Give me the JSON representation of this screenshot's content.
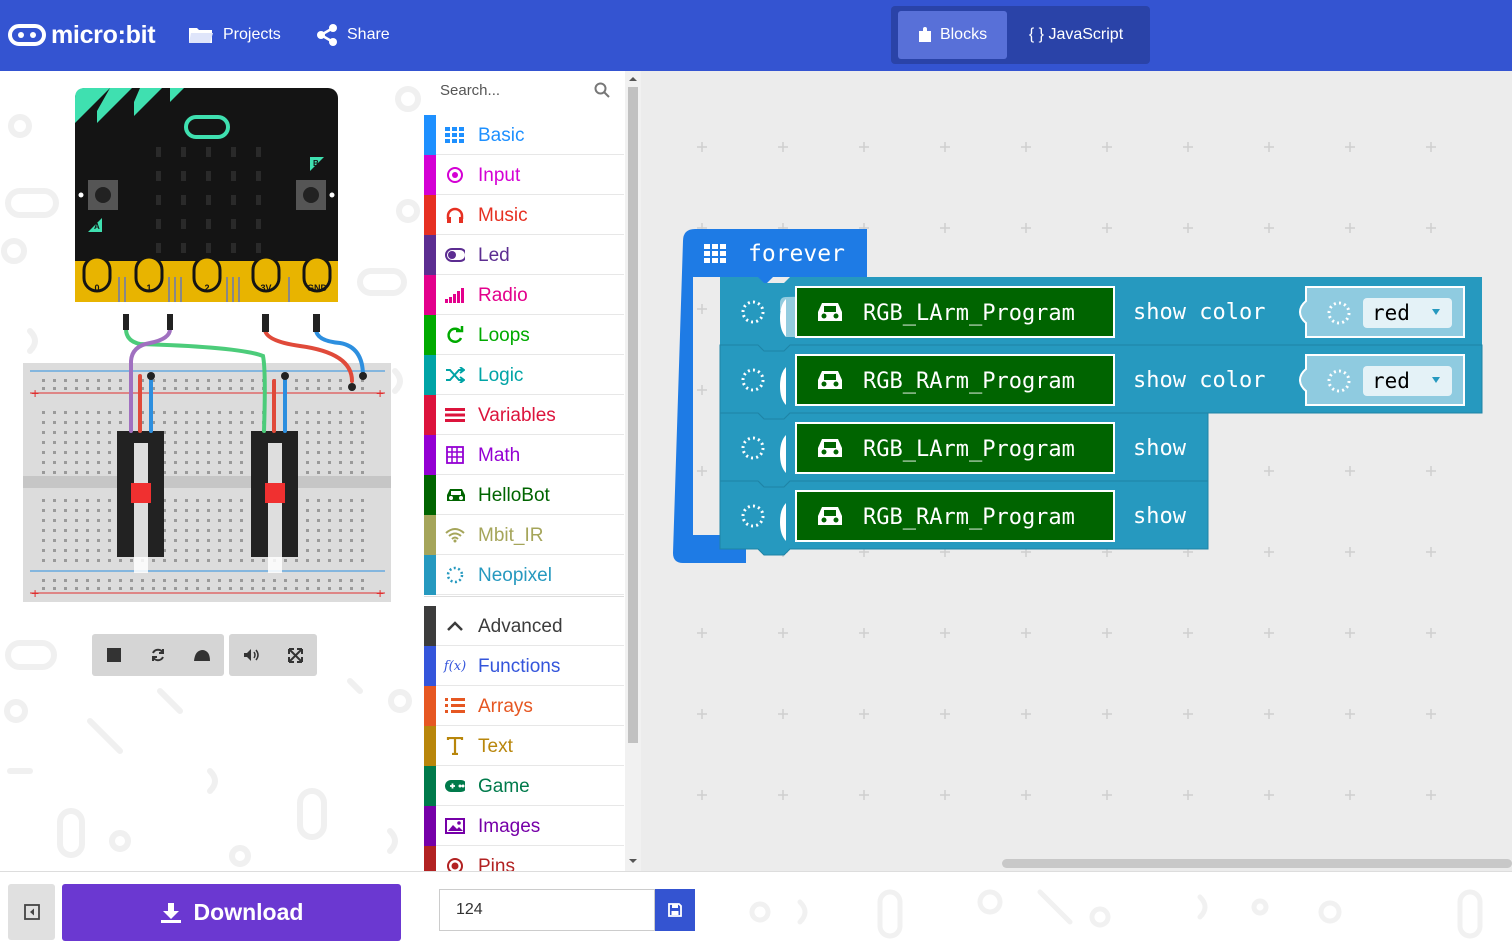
{
  "header": {
    "logo_text": "micro:bit",
    "projects_label": "Projects",
    "share_label": "Share",
    "mode_blocks_label": "Blocks",
    "mode_js_label": "{ } JavaScript"
  },
  "simulator": {
    "pin_labels": [
      "0",
      "1",
      "2",
      "3V",
      "GND"
    ],
    "button_a": "A",
    "button_b": "B",
    "controls": [
      "stop-icon",
      "restart-icon",
      "slowmo-icon",
      "mute-icon",
      "fullscreen-icon"
    ]
  },
  "toolbox": {
    "search_placeholder": "Search...",
    "categories": [
      {
        "label": "Basic",
        "color": "#1e90ff",
        "icon": "grid-icon"
      },
      {
        "label": "Input",
        "color": "#d400d4",
        "icon": "target-icon"
      },
      {
        "label": "Music",
        "color": "#e63022",
        "icon": "headphones-icon"
      },
      {
        "label": "Led",
        "color": "#5c2d91",
        "icon": "toggle-icon"
      },
      {
        "label": "Radio",
        "color": "#e3008c",
        "icon": "signal-icon"
      },
      {
        "label": "Loops",
        "color": "#00aa00",
        "icon": "loop-icon"
      },
      {
        "label": "Logic",
        "color": "#00a4a6",
        "icon": "shuffle-icon"
      },
      {
        "label": "Variables",
        "color": "#dc143c",
        "icon": "lines-icon"
      },
      {
        "label": "Math",
        "color": "#9400d3",
        "icon": "calculator-icon"
      },
      {
        "label": "HelloBot",
        "color": "#006400",
        "icon": "car-icon"
      },
      {
        "label": "Mbit_IR",
        "color": "#a5a55a",
        "icon": "wifi-icon"
      },
      {
        "label": "Neopixel",
        "color": "#2699bf",
        "icon": "ring-icon"
      }
    ],
    "advanced": [
      {
        "label": "Advanced",
        "color": "#3c3c3c",
        "icon": "chevron-up-icon"
      },
      {
        "label": "Functions",
        "color": "#3455db",
        "icon": "function-icon"
      },
      {
        "label": "Arrays",
        "color": "#e65722",
        "icon": "list-icon"
      },
      {
        "label": "Text",
        "color": "#b8860b",
        "icon": "text-icon"
      },
      {
        "label": "Game",
        "color": "#007a4b",
        "icon": "gamepad-icon"
      },
      {
        "label": "Images",
        "color": "#7600a8",
        "icon": "image-icon"
      },
      {
        "label": "Pins",
        "color": "#b22222",
        "icon": "pin-icon"
      }
    ]
  },
  "workspace": {
    "forever_label": "forever",
    "blocks": [
      {
        "object": "RGB_LArm_Program",
        "action": "show color",
        "value": "red"
      },
      {
        "object": "RGB_RArm_Program",
        "action": "show color",
        "value": "red"
      },
      {
        "object": "RGB_LArm_Program",
        "action": "show",
        "value": null
      },
      {
        "object": "RGB_RArm_Program",
        "action": "show",
        "value": null
      }
    ]
  },
  "footer": {
    "download_label": "Download",
    "project_name": "124"
  }
}
